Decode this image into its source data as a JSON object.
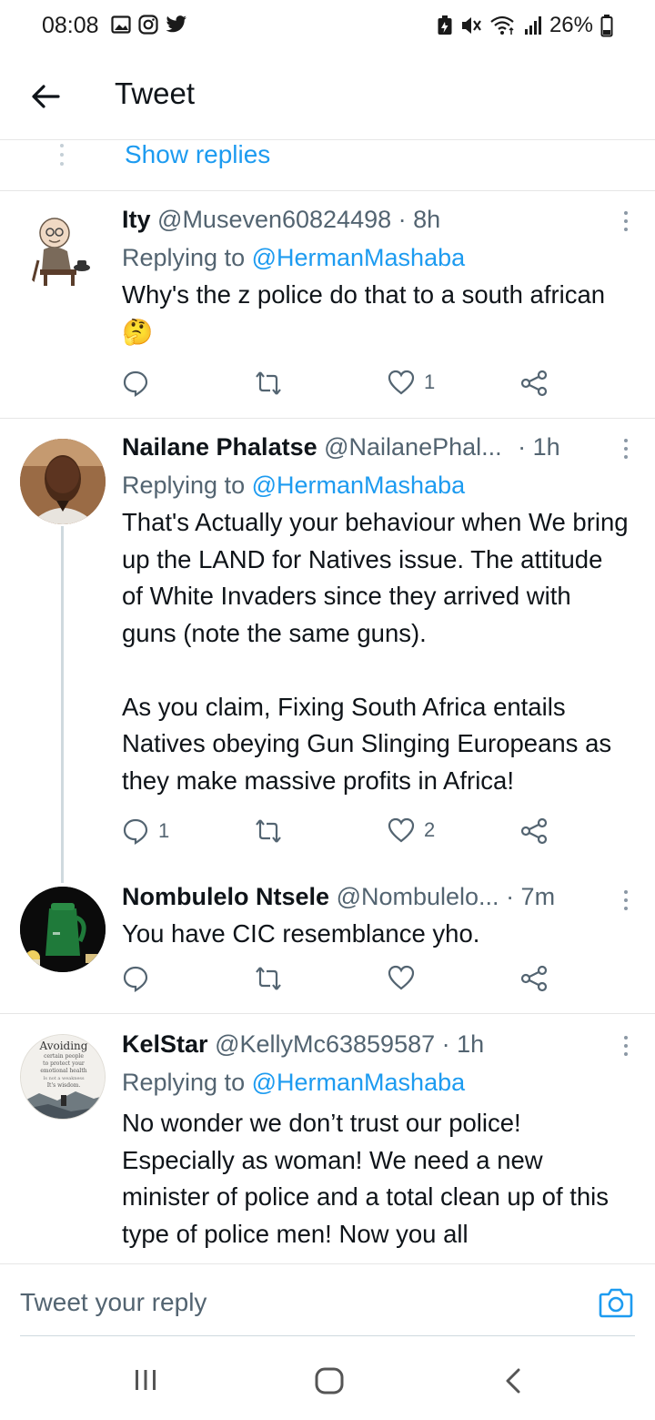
{
  "status_bar": {
    "time": "08:08",
    "battery": "26%",
    "left_icons": [
      "gallery-icon",
      "instagram-icon",
      "twitter-icon"
    ],
    "right_icons": [
      "battery-saver-icon",
      "mute-icon",
      "wifi-icon",
      "signal-icon",
      "battery-icon"
    ]
  },
  "header": {
    "title": "Tweet",
    "back_icon": "arrow-left-icon"
  },
  "show_replies": {
    "label": "Show replies"
  },
  "tweets": [
    {
      "name": "Ity",
      "handle": "@Museven60824498",
      "time": "· 8h",
      "replying_label": "Replying to",
      "replying_to": "@HermanMashaba",
      "text": "Why's the z police do that to a south african 🤔",
      "reply_count": "",
      "retweet_count": "",
      "like_count": "1"
    },
    {
      "name": "Nailane Phalatse",
      "handle": "@NailanePhal...",
      "time": "· 1h",
      "replying_label": "Replying to",
      "replying_to": "@HermanMashaba",
      "text": "That's Actually your behaviour when We bring up the LAND for Natives issue. The attitude of White Invaders since they arrived with guns (note the same guns).\n\nAs you claim, Fixing South Africa entails Natives obeying Gun Slinging Europeans as they make massive profits in Africa!",
      "reply_count": "1",
      "retweet_count": "",
      "like_count": "2"
    },
    {
      "name": "Nombulelo Ntsele",
      "handle": "@Nombulelo...",
      "time": "· 7m",
      "text": "You have CIC resemblance yho.",
      "reply_count": "",
      "retweet_count": "",
      "like_count": ""
    },
    {
      "name": "KelStar",
      "handle": "@KellyMc63859587",
      "time": "· 1h",
      "replying_label": "Replying to",
      "replying_to": "@HermanMashaba",
      "text": "No wonder we don’t trust our police! Especially as woman! We need a new minister of police and a total clean up of this type of police men! Now you all",
      "avatar_text": [
        "Avoiding",
        "certain people",
        "to protect your",
        "emotional health",
        "Is not a weakness",
        "It's wisdom."
      ]
    }
  ],
  "composer": {
    "placeholder": "Tweet your reply",
    "camera_icon": "camera-icon"
  },
  "colors": {
    "accent": "#1d9bf0",
    "text": "#0f1419",
    "secondary": "#536471",
    "divider": "#e6e6e6"
  }
}
